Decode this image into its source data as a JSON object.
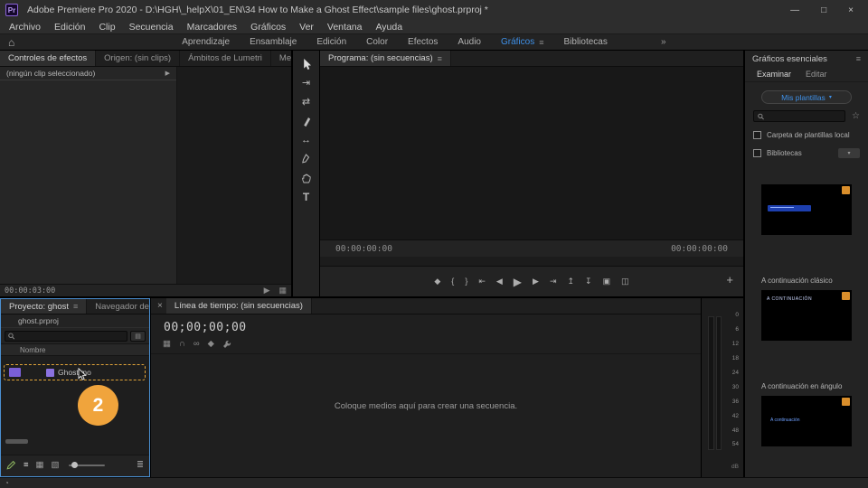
{
  "colors": {
    "accent_blue": "#3e90e8",
    "callout_orange": "#f0a43c",
    "selection_dash_orange": "#e0a339",
    "clip_purple": "#7a5fd8",
    "badge_orange": "#d98e2b",
    "pencil_green": "#8fb860",
    "focus_border_blue": "#4a8fd1"
  },
  "title_bar": {
    "app_badge": "Pr",
    "title": "Adobe Premiere Pro 2020 - D:\\HGH\\_helpX\\01_EN\\34 How to Make a Ghost Effect\\sample files\\ghost.prproj *",
    "minimize": "—",
    "maximize": "□",
    "close": "×"
  },
  "menu_bar": {
    "items": [
      "Archivo",
      "Edición",
      "Clip",
      "Secuencia",
      "Marcadores",
      "Gráficos",
      "Ver",
      "Ventana",
      "Ayuda"
    ]
  },
  "workspace_bar": {
    "tabs": [
      "Aprendizaje",
      "Ensamblaje",
      "Edición",
      "Color",
      "Efectos",
      "Audio",
      "Gráficos",
      "Bibliotecas"
    ],
    "active": "Gráficos",
    "overflow": "»"
  },
  "effect_controls": {
    "tab_effect_controls": "Controles de efectos",
    "tab_source": "Origen: (sin clips)",
    "tab_lumetri": "Ámbitos de Lumetri",
    "tab_mixer": "Mezcl",
    "overflow": "»",
    "empty_row": "(ningún clip seleccionado)",
    "timecode": "00:00:03:00"
  },
  "program_monitor": {
    "tab": "Programa: (sin secuencias)",
    "timecode_left": "00:00:00:00",
    "timecode_right": "00:00:00:00",
    "add_button": "+"
  },
  "essential_graphics": {
    "title": "Gráficos esenciales",
    "tab_browse": "Examinar",
    "tab_edit": "Editar",
    "my_templates_button": "Mis plantillas",
    "checkbox_local": "Carpeta de plantillas local",
    "checkbox_libraries": "Bibliotecas",
    "templates": [
      {
        "name": ""
      },
      {
        "name": "A continuación clásico",
        "overlay": "A CONTINUACIÓN"
      },
      {
        "name": "A continuación en ángulo",
        "overlay": "A continuación"
      }
    ]
  },
  "project_panel": {
    "tab_project": "Proyecto: ghost",
    "tab_media_browser": "Navegador de m",
    "overflow": "»",
    "project_file": "ghost.prproj",
    "column_name": "Nombre",
    "clip_name": "Ghost.mo",
    "callout_number": "2"
  },
  "timeline": {
    "close": "×",
    "tab": "Línea de tiempo: (sin secuencias)",
    "timecode": "00;00;00;00",
    "empty_message": "Coloque medios aquí para crear una secuencia."
  },
  "audio_meter": {
    "labels": [
      "0",
      "6",
      "12",
      "18",
      "24",
      "30",
      "36",
      "42",
      "48",
      "54"
    ],
    "unit": "dB"
  },
  "icons": {
    "home": "⌂",
    "panel_menu": "≡",
    "row_arrow": "▶",
    "ec_play": "▶",
    "ec_film": "▦",
    "add_marker": "◆",
    "mark_in": "{",
    "mark_out": "}",
    "go_to_in": "⇤",
    "step_back": "◀",
    "play": "▶",
    "step_forward": "▶",
    "go_to_out": "⇥",
    "lift": "↥",
    "extract": "↧",
    "export_frame": "▣",
    "comparison_view": "◫",
    "track_select": "⇥",
    "ripple_edit": "⇄",
    "slip": "↔",
    "type_tool": "T",
    "star": "☆",
    "dropdown": "▾",
    "search_options": "▤",
    "list_view": "≡",
    "icon_view": "▦",
    "freeform_view": "▧",
    "more_tools": "≣",
    "tl_settings": "▦",
    "snap": "∩",
    "linked_selection": "∞",
    "tl_marker": "◆",
    "status": "◔"
  }
}
